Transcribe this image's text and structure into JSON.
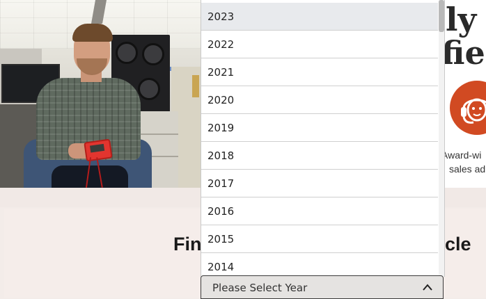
{
  "hero": {
    "photo_alt": "",
    "heading_lines": [
      "ly f",
      "fie"
    ]
  },
  "support": {
    "icon": "headset-support-icon",
    "text_lines": [
      "Award-wi",
      "sales ad"
    ],
    "accent_color": "#d14a22"
  },
  "find_section": {
    "text_left": "Fin",
    "text_right": "cle"
  },
  "year_dropdown": {
    "options": [
      "2023",
      "2022",
      "2021",
      "2020",
      "2019",
      "2018",
      "2017",
      "2016",
      "2015",
      "2014"
    ],
    "highlighted": "2023",
    "placeholder": "Please Select Year",
    "state": "open"
  }
}
